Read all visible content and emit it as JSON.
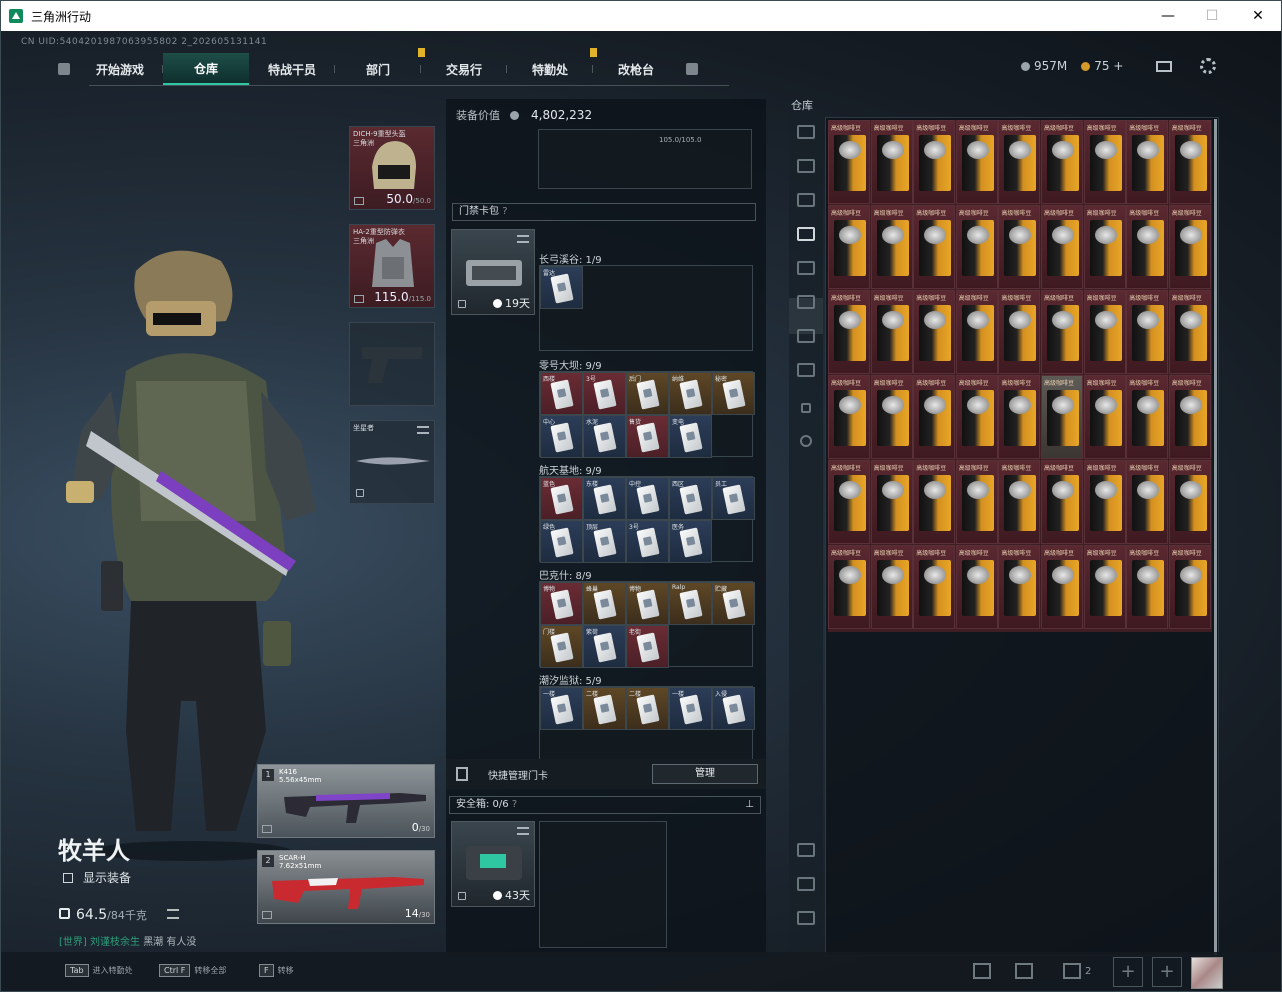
{
  "window": {
    "title": "三角洲行动",
    "min": "—",
    "max": "☐",
    "close": "✕"
  },
  "uid": "CN UID:5404201987063955802 2_202605131141",
  "nav": {
    "tabs": [
      "开始游戏",
      "仓库",
      "特战干员",
      "部门",
      "交易行",
      "特勤处",
      "改枪台"
    ],
    "active": 1
  },
  "currency": {
    "silver": "957M",
    "gold": "75 +"
  },
  "player": {
    "name": "牧羊人",
    "show_equip_label": "显示装备",
    "weight": "64.5",
    "weight_max": "/84千克",
    "chat_channel": "[世界]",
    "chat_user": "刘谨枝余生",
    "chat_text": "黑潮 有人没"
  },
  "gear": {
    "helmet_name": "DICH-9重型头盔 三角洲",
    "helmet_val": "50.0",
    "helmet_max": "/50.0",
    "armor_name": "HA-2重型防弹衣 三角洲",
    "armor_val": "115.0",
    "armor_max": "/115.0",
    "melee_name": "坐星者"
  },
  "weapons": [
    {
      "num": "1",
      "name": "K416",
      "caliber": "5.56x45mm",
      "ammo": "0",
      "max": "/30"
    },
    {
      "num": "2",
      "name": "SCAR-H",
      "caliber": "7.62x51mm",
      "ammo": "14",
      "max": "/30"
    }
  ],
  "equip_value": {
    "label": "装备价值",
    "value": "4,802,232"
  },
  "top_bar_text": "105.0/105.0",
  "keycard": {
    "header": "门禁卡包",
    "days": "19天",
    "zones": [
      "长弓溪谷: 1/9",
      "零号大坝: 9/9",
      "航天基地: 9/9",
      "巴克什: 8/9",
      "潮汐监狱: 5/9"
    ],
    "zone_cards": [
      [
        "雷达"
      ],
      [
        "西楼",
        "3号",
        "后门",
        "纳维",
        "秘密",
        "中心",
        "水泥",
        "售货",
        "变电"
      ],
      [
        "蓝色",
        "东楼",
        "中控",
        "西区",
        "员工",
        "绿色",
        "顶层",
        "3号",
        "医务"
      ],
      [
        "博物",
        "蜂巢",
        "博物",
        "Ralp",
        "贮藏",
        "门楼",
        "紫荷",
        "老街"
      ],
      [
        "一楼",
        "二楼",
        "二楼",
        "一楼",
        "入侵"
      ]
    ]
  },
  "quick_card": {
    "label": "快捷管理门卡",
    "button": "管理"
  },
  "safe_box": {
    "header": "安全箱: 0/6",
    "days": "43天"
  },
  "warehouse": {
    "label": "仓库",
    "item_label": "高级咖啡豆",
    "rows": 6,
    "cols": 9
  },
  "bottom": {
    "hints": [
      {
        "key": "Tab",
        "label": "进入特勤处"
      },
      {
        "key": "Ctrl F",
        "label": "转移全部"
      },
      {
        "key": "F",
        "label": "转移"
      }
    ],
    "friends": "2"
  }
}
